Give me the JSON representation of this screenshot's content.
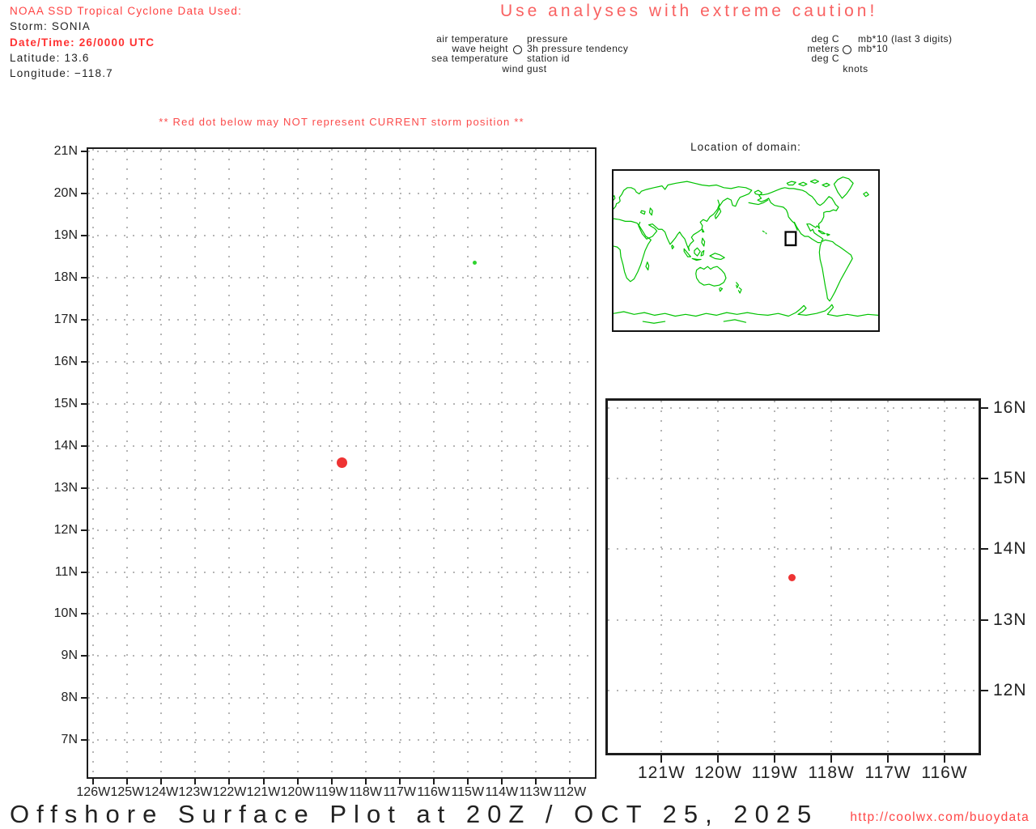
{
  "info_block": {
    "line1": "NOAA SSD Tropical Cyclone Data Used:",
    "line2": "Storm: SONIA",
    "line3": "Date/Time: 26/0000 UTC",
    "line4": "Latitude: 13.6",
    "line5": "Longitude: −118.7"
  },
  "caution_banner": "Use analyses with extreme caution!",
  "station_legend": {
    "labels": {
      "air_temp": "air temperature",
      "pressure": "pressure",
      "wave_height": "wave height",
      "pressure_tendency": "3h pressure tendency",
      "sea_temp": "sea temperature",
      "station_id": "station id",
      "wind_gust": "wind gust"
    },
    "units": {
      "air_temp": "deg C",
      "pressure": "mb*10 (last 3 digits)",
      "wave_height": "meters",
      "pressure_tendency": "mb*10",
      "sea_temp": "deg C",
      "wind_gust": "knots"
    }
  },
  "warning_note": "** Red dot below may NOT represent CURRENT storm position **",
  "domain_map": {
    "title": "Location of domain:"
  },
  "footer": {
    "title": "Offshore Surface Plot at 20Z / OCT 25, 2025",
    "url": "http://coolwx.com/buoydata"
  },
  "colors": {
    "header_red": "#ff4242",
    "datetime_red": "#ff3232",
    "caution_red": "#f96262",
    "warning_red": "#fb4b4b",
    "url_red": "#ff4545",
    "storm_dot_red": "#ee3333",
    "coastline_green": "#00c300",
    "grid_gray": "#b5b5b5",
    "ink_black": "#1f1f1f"
  },
  "chart_data": [
    {
      "type": "scatter",
      "name": "main offshore domain plot",
      "grid": true,
      "tick_len": 7,
      "y_label_side": "left",
      "xlim": [
        -126.15,
        -111.26
      ],
      "ylim": [
        6.12,
        21.06
      ],
      "x_tick_values": [
        -126,
        -125,
        -124,
        -123,
        -122,
        -121,
        -120,
        -119,
        -118,
        -117,
        -116,
        -115,
        -114,
        -113,
        -112
      ],
      "x_tick_labels": [
        "126W",
        "125W",
        "124W",
        "123W",
        "122W",
        "121W",
        "120W",
        "119W",
        "118W",
        "117W",
        "116W",
        "115W",
        "114W",
        "113W",
        "112W"
      ],
      "y_tick_values": [
        21,
        20,
        19,
        18,
        17,
        16,
        15,
        14,
        13,
        12,
        11,
        10,
        9,
        8,
        7
      ],
      "y_tick_labels": [
        "21N",
        "20N",
        "19N",
        "18N",
        "17N",
        "16N",
        "15N",
        "14N",
        "13N",
        "12N",
        "11N",
        "10N",
        "9N",
        "8N",
        "7N"
      ],
      "points": [
        {
          "name": "storm-position-dot",
          "lon": -118.7,
          "lat": 13.6,
          "diameter": 13,
          "color": "#ee3333"
        },
        {
          "name": "coastline-speck",
          "lon": -114.8,
          "lat": 18.36,
          "diameter": 5,
          "color": "#2fd32f"
        }
      ]
    },
    {
      "type": "scatter",
      "name": "storm detail plot",
      "grid": true,
      "tick_len": 10,
      "y_label_side": "right",
      "xlim": [
        -121.95,
        -115.4
      ],
      "ylim": [
        11.12,
        16.1
      ],
      "x_tick_values": [
        -121,
        -120,
        -119,
        -118,
        -117,
        -116
      ],
      "x_tick_labels": [
        "121W",
        "120W",
        "119W",
        "118W",
        "117W",
        "116W"
      ],
      "y_tick_values": [
        16,
        15,
        14,
        13,
        12
      ],
      "y_tick_labels": [
        "16N",
        "15N",
        "14N",
        "13N",
        "12N"
      ],
      "points": [
        {
          "name": "storm-position-dot",
          "lon": -118.7,
          "lat": 13.6,
          "diameter": 9,
          "color": "#ee3333"
        }
      ]
    }
  ]
}
